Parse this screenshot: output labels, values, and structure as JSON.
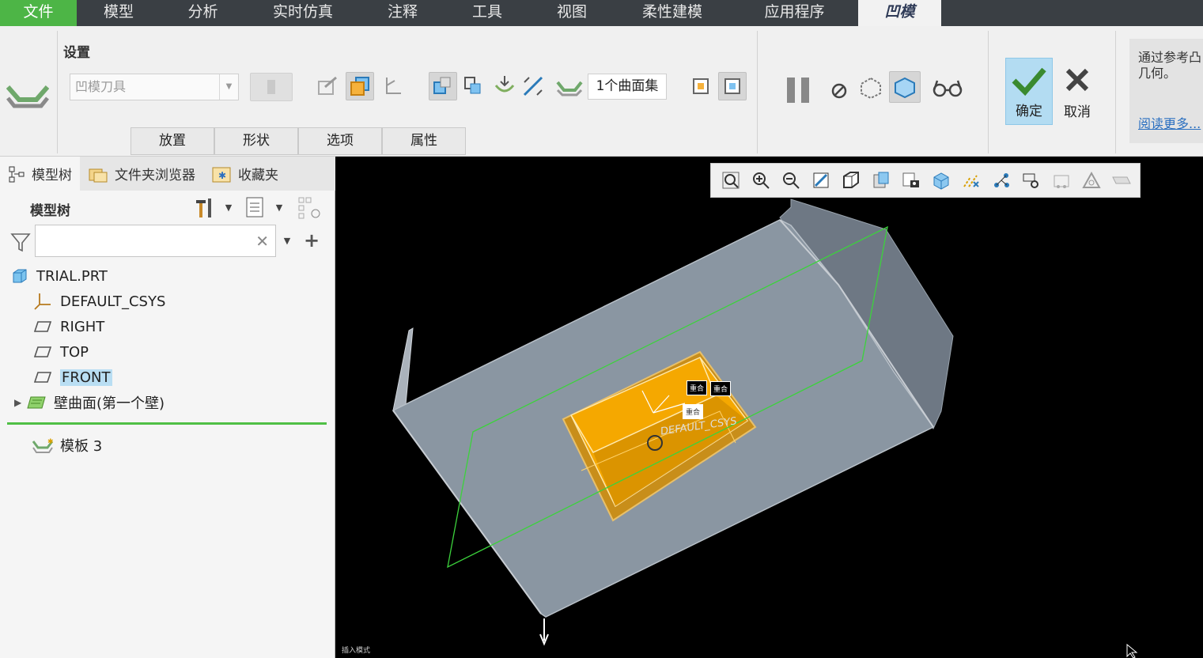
{
  "tabs": {
    "file": "文件",
    "model": "模型",
    "analysis": "分析",
    "simulate": "实时仿真",
    "annotate": "注释",
    "tools": "工具",
    "view": "视图",
    "flexible": "柔性建模",
    "apps": "应用程序",
    "form": "凹模"
  },
  "ribbon": {
    "settings_title": "设置",
    "tool_combo_value": "凹模刀具",
    "surface_set": "1个曲面集",
    "subtabs": [
      "放置",
      "形状",
      "选项",
      "属性"
    ],
    "ok_label": "确定",
    "cancel_label": "取消",
    "help_line1": "通过参考凸",
    "help_line2": "几何。",
    "help_more": "阅读更多..."
  },
  "navigator": {
    "tabs": [
      "模型树",
      "文件夹浏览器",
      "收藏夹"
    ],
    "title": "模型树",
    "filter_value": "",
    "items": [
      {
        "label": "TRIAL.PRT",
        "icon": "part-icon"
      },
      {
        "label": "DEFAULT_CSYS",
        "icon": "csys-icon"
      },
      {
        "label": "RIGHT",
        "icon": "datum-plane-icon"
      },
      {
        "label": "TOP",
        "icon": "datum-plane-icon"
      },
      {
        "label": "FRONT",
        "icon": "datum-plane-icon"
      },
      {
        "label": "壁曲面(第一个壁)",
        "icon": "wall-icon"
      },
      {
        "label": "模板 3",
        "icon": "form-feature-icon"
      }
    ]
  },
  "viewport": {
    "csys_label": "DEFAULT_CSYS",
    "tag1": "重合",
    "tag2": "重合",
    "tag3": "重合",
    "status": "插入模式"
  },
  "colors": {
    "file_tab": "#4db546",
    "tabbar": "#3a3f44",
    "ok_button": "#b3dcf2",
    "selection": "#b9def3",
    "sheet": "#8c98a4",
    "punch": "#f5a800",
    "datum": "#3cd23c"
  }
}
